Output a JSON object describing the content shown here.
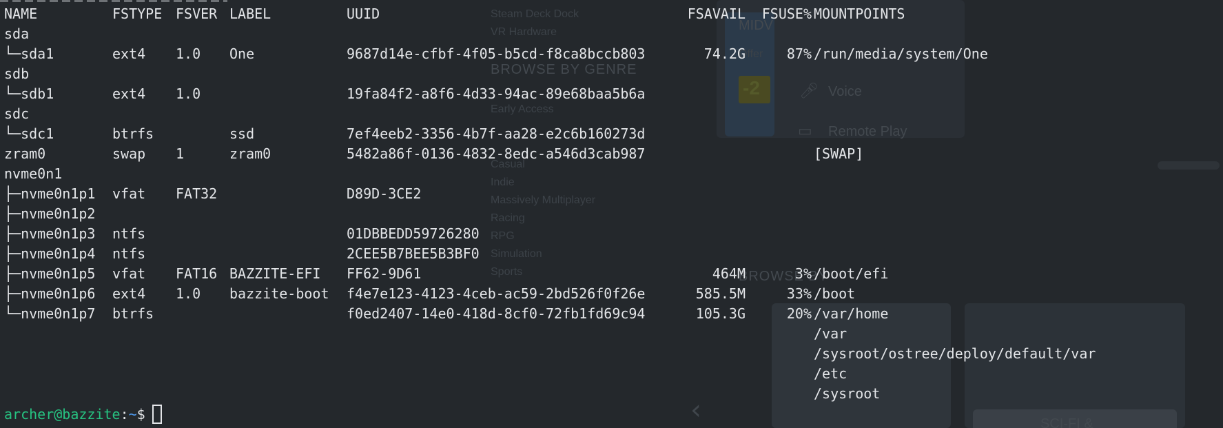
{
  "background_window": {
    "menu_items": [
      "Steam Deck Dock",
      "VR Hardware",
      "BROWSE BY GENRE",
      "Early Access",
      "Casual",
      "Indie",
      "Massively Multiplayer",
      "Racing",
      "RPG",
      "Simulation",
      "Sports"
    ],
    "card_title": "MIDV",
    "card_offer": "Offer",
    "discount_badge": "-2",
    "voice_label": "Voice",
    "remote_play_label": "Remote Play",
    "browse_heading": "BROWSE BY",
    "bottom_button": "SCI-FI &"
  },
  "terminal": {
    "headers": {
      "name": "NAME",
      "fstype": "FSTYPE",
      "fsver": "FSVER",
      "label": "LABEL",
      "uuid": "UUID",
      "fsavail": "FSAVAIL",
      "fsuse": "FSUSE%",
      "mountpoints": "MOUNTPOINTS"
    },
    "rows": [
      {
        "name": "sda",
        "fstype": "",
        "fsver": "",
        "label": "",
        "uuid": "",
        "fsavail": "",
        "fsuse": "",
        "mount": ""
      },
      {
        "name": "└─sda1",
        "fstype": "ext4",
        "fsver": "1.0",
        "label": "One",
        "uuid": "9687d14e-cfbf-4f05-b5cd-f8ca8bccb803",
        "fsavail": "74.2G",
        "fsuse": "87%",
        "mount": "/run/media/system/One"
      },
      {
        "name": "sdb",
        "fstype": "",
        "fsver": "",
        "label": "",
        "uuid": "",
        "fsavail": "",
        "fsuse": "",
        "mount": ""
      },
      {
        "name": "└─sdb1",
        "fstype": "ext4",
        "fsver": "1.0",
        "label": "",
        "uuid": "19fa84f2-a8f6-4d33-94ac-89e68baa5b6a",
        "fsavail": "",
        "fsuse": "",
        "mount": ""
      },
      {
        "name": "sdc",
        "fstype": "",
        "fsver": "",
        "label": "",
        "uuid": "",
        "fsavail": "",
        "fsuse": "",
        "mount": ""
      },
      {
        "name": "└─sdc1",
        "fstype": "btrfs",
        "fsver": "",
        "label": "ssd",
        "uuid": "7ef4eeb2-3356-4b7f-aa28-e2c6b160273d",
        "fsavail": "",
        "fsuse": "",
        "mount": ""
      },
      {
        "name": "zram0",
        "fstype": "swap",
        "fsver": "1",
        "label": "zram0",
        "uuid": "5482a86f-0136-4832-8edc-a546d3cab987",
        "fsavail": "",
        "fsuse": "",
        "mount": "[SWAP]"
      },
      {
        "name": "nvme0n1",
        "fstype": "",
        "fsver": "",
        "label": "",
        "uuid": "",
        "fsavail": "",
        "fsuse": "",
        "mount": ""
      },
      {
        "name": "├─nvme0n1p1",
        "fstype": "vfat",
        "fsver": "FAT32",
        "label": "",
        "uuid": "D89D-3CE2",
        "fsavail": "",
        "fsuse": "",
        "mount": ""
      },
      {
        "name": "├─nvme0n1p2",
        "fstype": "",
        "fsver": "",
        "label": "",
        "uuid": "",
        "fsavail": "",
        "fsuse": "",
        "mount": ""
      },
      {
        "name": "├─nvme0n1p3",
        "fstype": "ntfs",
        "fsver": "",
        "label": "",
        "uuid": "01DBBEDD59726280",
        "fsavail": "",
        "fsuse": "",
        "mount": ""
      },
      {
        "name": "├─nvme0n1p4",
        "fstype": "ntfs",
        "fsver": "",
        "label": "",
        "uuid": "2CEE5B7BEE5B3BF0",
        "fsavail": "",
        "fsuse": "",
        "mount": ""
      },
      {
        "name": "├─nvme0n1p5",
        "fstype": "vfat",
        "fsver": "FAT16",
        "label": "BAZZITE-EFI",
        "uuid": "FF62-9D61",
        "fsavail": "464M",
        "fsuse": "3%",
        "mount": "/boot/efi"
      },
      {
        "name": "├─nvme0n1p6",
        "fstype": "ext4",
        "fsver": "1.0",
        "label": "bazzite-boot",
        "uuid": "f4e7e123-4123-4ceb-ac59-2bd526f0f26e",
        "fsavail": "585.5M",
        "fsuse": "33%",
        "mount": "/boot"
      },
      {
        "name": "└─nvme0n1p7",
        "fstype": "btrfs",
        "fsver": "",
        "label": "",
        "uuid": "f0ed2407-14e0-418d-8cf0-72fb1fd69c94",
        "fsavail": "105.3G",
        "fsuse": "20%",
        "mount": "/var/home"
      },
      {
        "name": "",
        "fstype": "",
        "fsver": "",
        "label": "",
        "uuid": "",
        "fsavail": "",
        "fsuse": "",
        "mount": "/var"
      },
      {
        "name": "",
        "fstype": "",
        "fsver": "",
        "label": "",
        "uuid": "",
        "fsavail": "",
        "fsuse": "",
        "mount": "/sysroot/ostree/deploy/default/var"
      },
      {
        "name": "",
        "fstype": "",
        "fsver": "",
        "label": "",
        "uuid": "",
        "fsavail": "",
        "fsuse": "",
        "mount": "/etc"
      },
      {
        "name": "",
        "fstype": "",
        "fsver": "",
        "label": "",
        "uuid": "",
        "fsavail": "",
        "fsuse": "",
        "mount": "/sysroot"
      }
    ],
    "prompt": {
      "user_host": "archer@bazzite",
      "colon": ":",
      "path": "~",
      "symbol": "$"
    },
    "colors": {
      "background": "#24282c",
      "text": "#e3e5e8",
      "prompt_user": "#26c281",
      "prompt_path": "#4f9bf0"
    }
  }
}
